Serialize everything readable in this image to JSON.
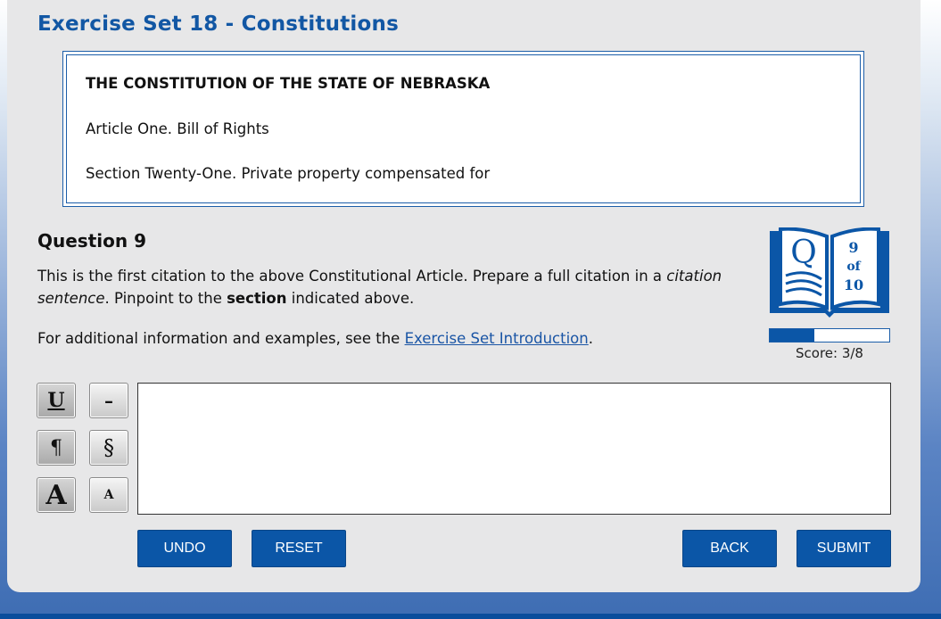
{
  "header": {
    "title": "Exercise Set 18 - Constitutions"
  },
  "constitution": {
    "title": "THE CONSTITUTION OF THE STATE OF NEBRASKA",
    "article": "Article One. Bill of Rights",
    "section": "Section Twenty-One. Private property compensated for"
  },
  "question": {
    "title": "Question 9",
    "text_part1": "This is the first citation to the above Constitutional Article. Prepare a full citation in a ",
    "text_italic": "citation sentence",
    "text_part2": ". Pinpoint to the ",
    "text_bold": "section",
    "text_part3": " indicated above.",
    "info_prefix": "For additional information and examples, see the ",
    "info_link": "Exercise Set Introduction",
    "info_suffix": "."
  },
  "progress": {
    "book_letter": "Q",
    "current": "9",
    "of_label": "of",
    "total": "10",
    "fill_fraction": 0.375,
    "score_text": "Score: 3/8"
  },
  "tools": {
    "underline": "U",
    "dash": "–",
    "pilcrow": "¶",
    "section": "§",
    "large_font": "A",
    "small_font": "A"
  },
  "answer": {
    "value": ""
  },
  "buttons": {
    "undo": "UNDO",
    "reset": "RESET",
    "back": "BACK",
    "submit": "SUBMIT"
  },
  "colors": {
    "accent": "#0b56a7",
    "title": "#1257a4",
    "panel": "#e7e7e8"
  }
}
